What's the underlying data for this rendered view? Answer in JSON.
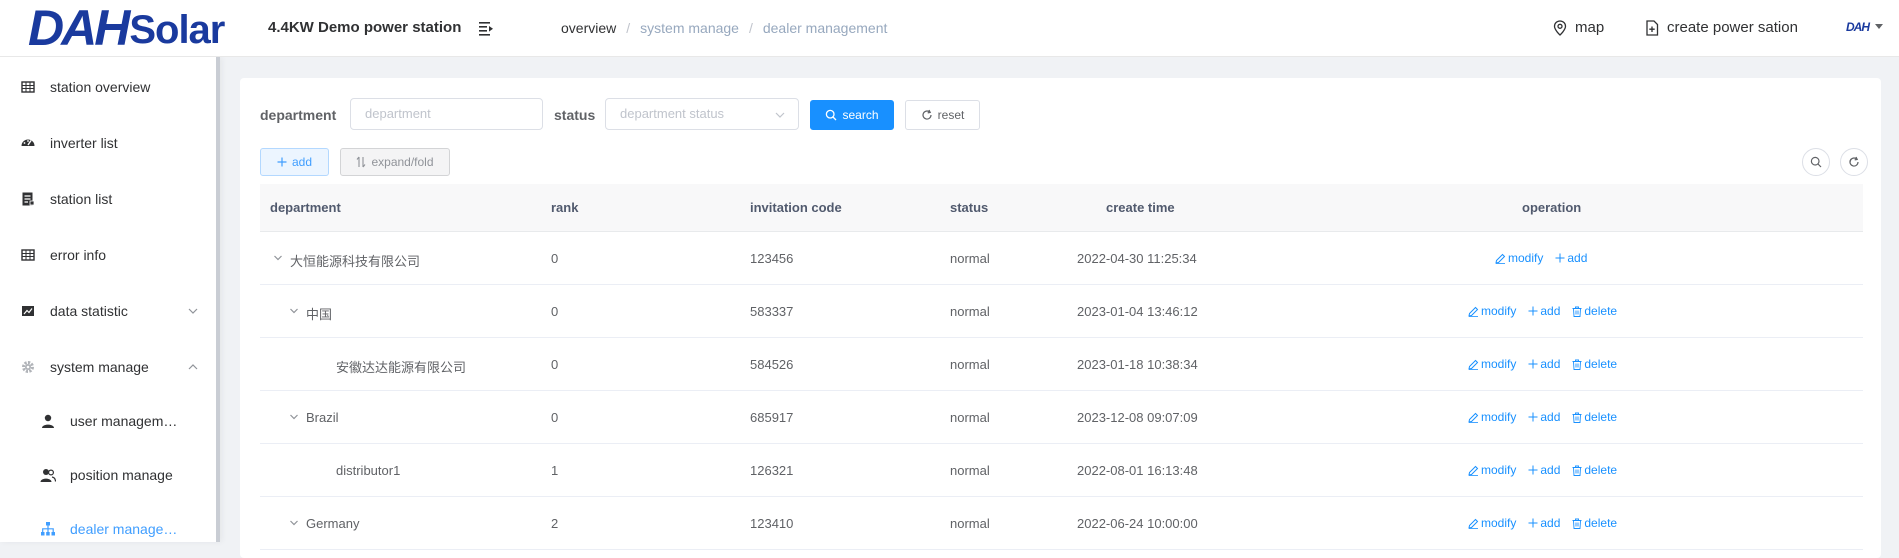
{
  "app": {
    "logo_mark": "DAH",
    "logo_text": "Solar",
    "station_title": "4.4KW Demo power station"
  },
  "breadcrumb": [
    "overview",
    "system manage",
    "dealer management"
  ],
  "header_links": {
    "map": "map",
    "create": "create power sation"
  },
  "avatar_text": "DAH",
  "sidebar": {
    "items": [
      {
        "label": "station overview",
        "icon": "grid-icon"
      },
      {
        "label": "inverter list",
        "icon": "dashboard-icon"
      },
      {
        "label": "station list",
        "icon": "document-icon"
      },
      {
        "label": "error info",
        "icon": "table-icon"
      },
      {
        "label": "data statistic",
        "icon": "chart-icon"
      },
      {
        "label": "system manage",
        "icon": "gear-icon"
      }
    ],
    "subitems": [
      {
        "label": "user management",
        "icon": "user-icon"
      },
      {
        "label": "position manage",
        "icon": "users-icon"
      },
      {
        "label": "dealer management",
        "icon": "tree-icon"
      }
    ]
  },
  "filters": {
    "department_label": "department",
    "department_placeholder": "department",
    "status_label": "status",
    "status_placeholder": "department status",
    "search_label": "search",
    "reset_label": "reset"
  },
  "toolbar": {
    "add_label": "add",
    "expand_label": "expand/fold"
  },
  "table": {
    "headers": [
      "department",
      "rank",
      "invitation code",
      "status",
      "create time",
      "operation"
    ],
    "rows": [
      {
        "department": "大恒能源科技有限公司",
        "rank": "0",
        "code": "123456",
        "status": "normal",
        "time": "2022-04-30 11:25:34",
        "level": 0,
        "expandable": true,
        "can_delete": false
      },
      {
        "department": "中国",
        "rank": "0",
        "code": "583337",
        "status": "normal",
        "time": "2023-01-04 13:46:12",
        "level": 1,
        "expandable": true,
        "can_delete": true
      },
      {
        "department": "安徽达达能源有限公司",
        "rank": "0",
        "code": "584526",
        "status": "normal",
        "time": "2023-01-18 10:38:34",
        "level": 2,
        "expandable": false,
        "can_delete": true
      },
      {
        "department": "Brazil",
        "rank": "0",
        "code": "685917",
        "status": "normal",
        "time": "2023-12-08 09:07:09",
        "level": 1,
        "expandable": true,
        "can_delete": true
      },
      {
        "department": "distributor1",
        "rank": "1",
        "code": "126321",
        "status": "normal",
        "time": "2022-08-01 16:13:48",
        "level": 2,
        "expandable": false,
        "can_delete": true
      },
      {
        "department": "Germany",
        "rank": "2",
        "code": "123410",
        "status": "normal",
        "time": "2022-06-24 10:00:00",
        "level": 1,
        "expandable": true,
        "can_delete": true
      }
    ],
    "ops": {
      "modify": "modify",
      "add": "add",
      "delete": "delete"
    }
  },
  "colors": {
    "accent": "#1890ff",
    "highlight": "#f2321f",
    "brand": "#1a3a9e"
  }
}
